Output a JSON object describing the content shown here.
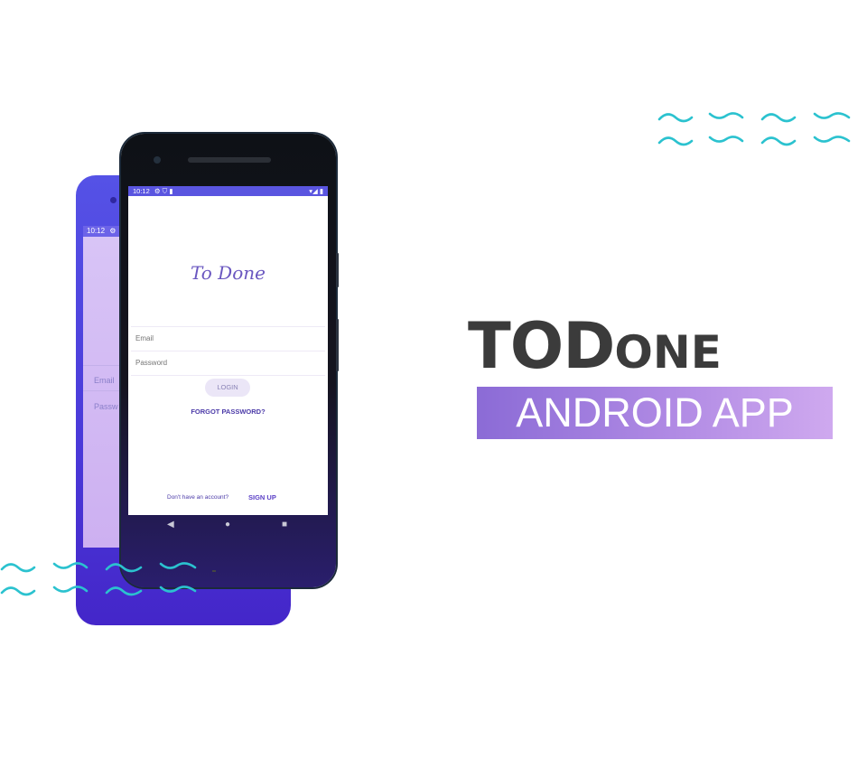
{
  "colors": {
    "accent": "#5a55e0",
    "wave": "#2bc2cf",
    "brand_text": "#3b3b3b",
    "banner_start": "#8b6bd6",
    "banner_end": "#cfa9ef"
  },
  "front_phone": {
    "status_time": "10:12",
    "status_left_icons": "⚙ ⛉ ▮",
    "status_right_icons": "▾◢ ▮",
    "app_title": "To Done",
    "email_placeholder": "Email",
    "password_placeholder": "Password",
    "login_label": "LOGIN",
    "forgot_label": "FORGOT PASSWORD?",
    "no_account_text": "Don't have an account?",
    "signup_label": "SIGN UP",
    "nav": {
      "back": "◀",
      "home": "●",
      "recents": "■"
    }
  },
  "back_phone": {
    "status_time": "10:12",
    "status_icon": "⚙",
    "email_label": "Email",
    "password_label": "Passw"
  },
  "brand": {
    "big": "TOD",
    "small": "ONE",
    "banner": "ANDROID APP"
  },
  "icons": [
    "wave-icon",
    "camera-icon",
    "speaker-icon",
    "back-nav-icon",
    "home-nav-icon",
    "recents-nav-icon"
  ]
}
